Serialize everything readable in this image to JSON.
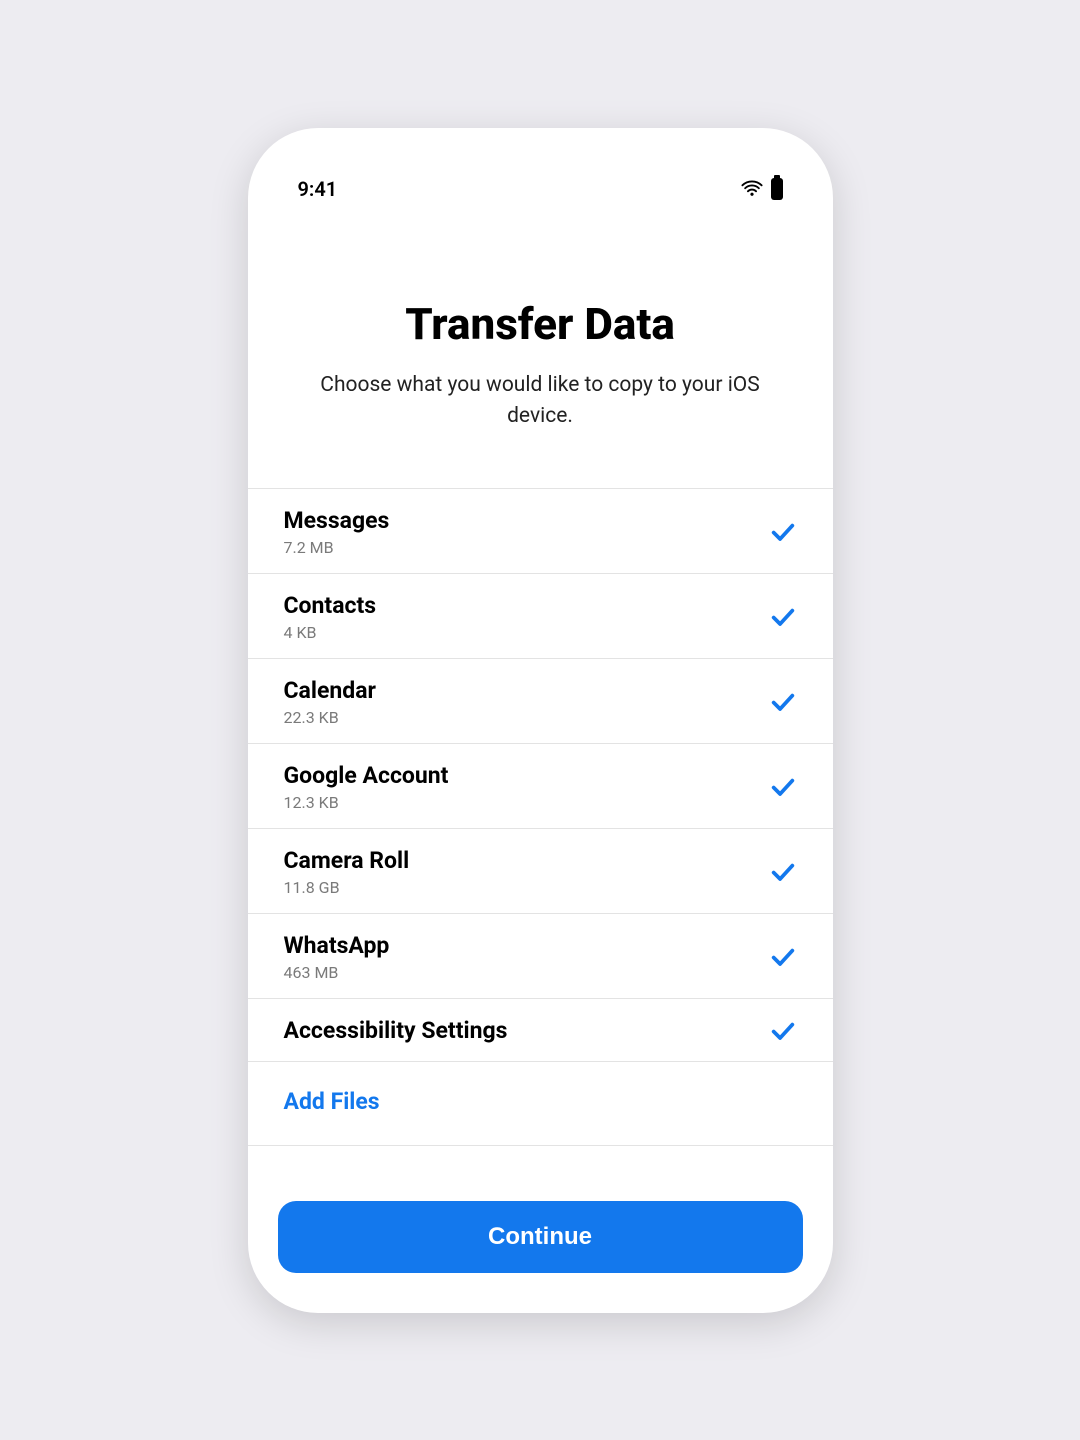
{
  "status": {
    "time": "9:41"
  },
  "header": {
    "title": "Transfer Data",
    "subtitle": "Choose what you would like to copy to your iOS device."
  },
  "items": [
    {
      "label": "Messages",
      "size": "7.2 MB",
      "selected": true
    },
    {
      "label": "Contacts",
      "size": "4 KB",
      "selected": true
    },
    {
      "label": "Calendar",
      "size": "22.3 KB",
      "selected": true
    },
    {
      "label": "Google Account",
      "size": "12.3 KB",
      "selected": true
    },
    {
      "label": "Camera Roll",
      "size": "11.8 GB",
      "selected": true
    },
    {
      "label": "WhatsApp",
      "size": "463 MB",
      "selected": true
    },
    {
      "label": "Accessibility Settings",
      "size": "",
      "selected": true
    }
  ],
  "actions": {
    "add_files_label": "Add Files",
    "continue_label": "Continue"
  },
  "colors": {
    "accent": "#1378ed"
  }
}
